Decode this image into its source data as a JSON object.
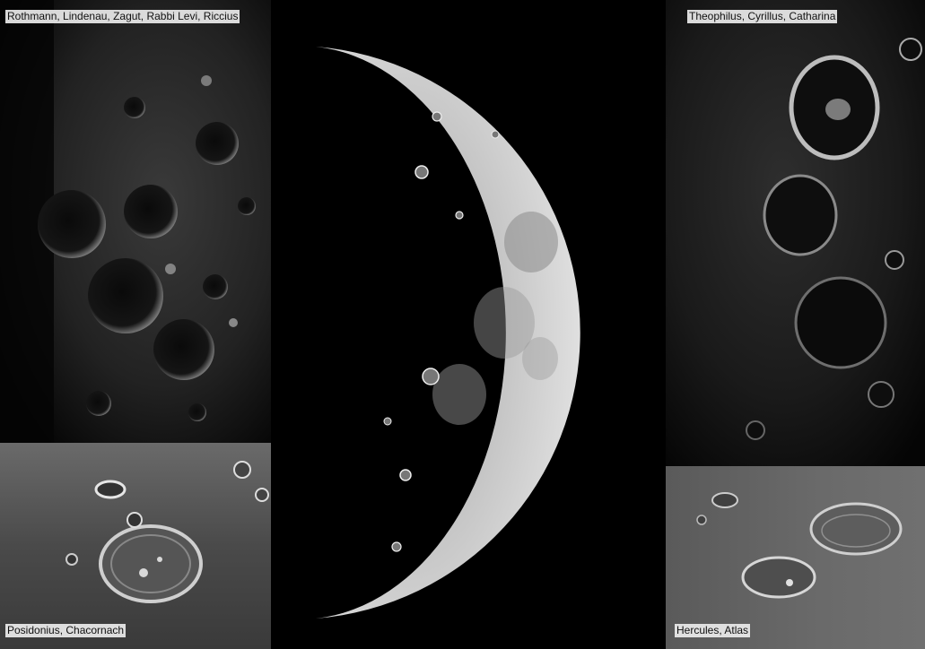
{
  "panels": {
    "top_left": {
      "label": "Rothmann, Lindenau, Zagut, Rabbi Levi, Riccius"
    },
    "bottom_left": {
      "label": "Posidonius, Chacornach"
    },
    "top_right": {
      "label": "Theophilus, Cyrillus, Catharina"
    },
    "bottom_right": {
      "label": "Hercules, Atlas"
    }
  },
  "colors": {
    "background": "#000000",
    "label_bg": "#ebebeb",
    "label_text": "#111111"
  }
}
